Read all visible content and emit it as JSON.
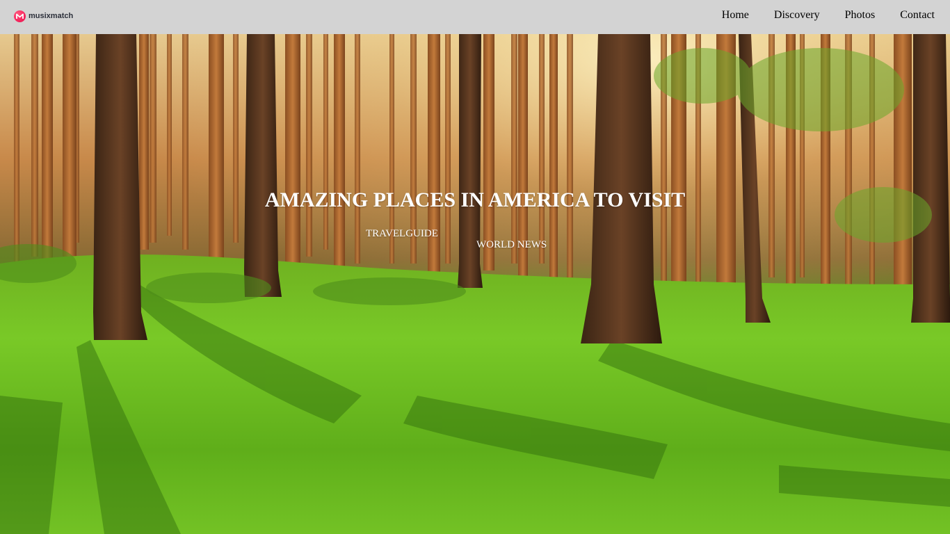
{
  "brand": {
    "name": "musixmatch",
    "logo_icon": "musixmatch-logo-icon",
    "accent_color": "#f8275f"
  },
  "nav": {
    "background": "#d3d3d3",
    "items": [
      {
        "label": "Home"
      },
      {
        "label": "Discovery"
      },
      {
        "label": "Photos"
      },
      {
        "label": "Contact"
      }
    ]
  },
  "hero": {
    "background_image": "sunlit pine forest with green mossy floor",
    "headline": "AMAZING PLACES IN AMERICA TO VISIT",
    "links": [
      {
        "label": "TRAVELGUIDE"
      },
      {
        "label": "WORLD NEWS"
      }
    ]
  }
}
